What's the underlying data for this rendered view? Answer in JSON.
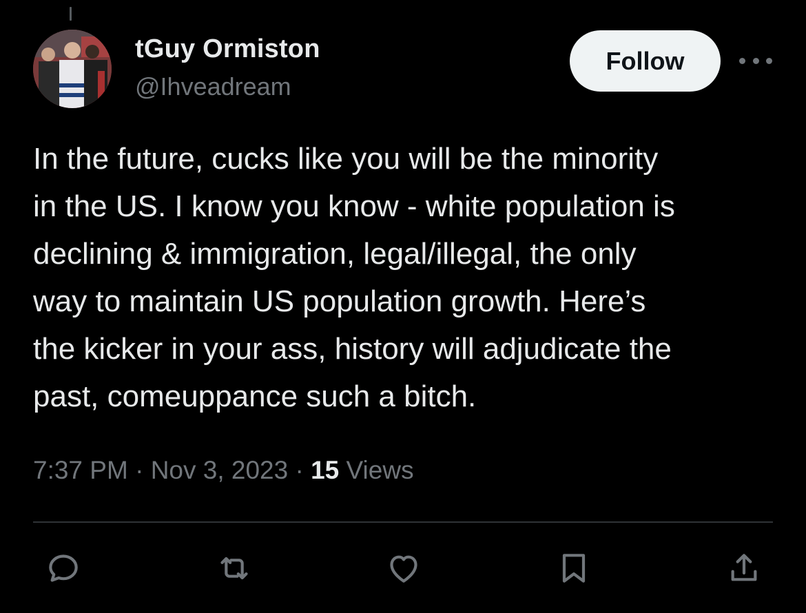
{
  "user": {
    "display_name": "tGuy Ormiston",
    "handle": "@Ihveadream"
  },
  "follow_label": "Follow",
  "tweet": {
    "text": "In the future, cucks like you will be the minority\nin the US. I know you know - white population is\ndeclining & immigration, legal/illegal, the only\nway to maintain US population growth. Here’s\nthe kicker in your ass, history will adjudicate the\npast, comeuppance such a bitch.",
    "time": "7:37 PM",
    "date": "Nov 3, 2023",
    "separator": "·",
    "views_count": "15",
    "views_label": "Views"
  },
  "actions": {
    "reply_icon": "reply-icon",
    "retweet_icon": "retweet-icon",
    "like_icon": "heart-icon",
    "bookmark_icon": "bookmark-icon",
    "share_icon": "share-icon"
  },
  "colors": {
    "background": "#000000",
    "primary_text": "#e7e9ea",
    "secondary_text": "#71767b",
    "divider": "#2f3336",
    "follow_bg": "#eff3f4"
  }
}
